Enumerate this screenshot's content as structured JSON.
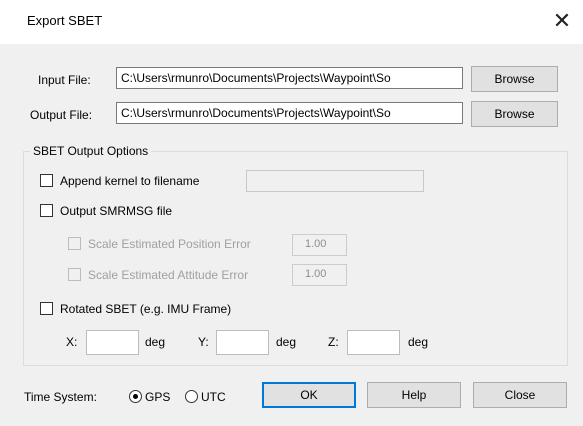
{
  "window": {
    "title": "Export SBET",
    "close_glyph": "✕"
  },
  "input_file": {
    "label": "Input File:",
    "value": "C:\\Users\\rmunro\\Documents\\Projects\\Waypoint\\So",
    "browse_label": "Browse"
  },
  "output_file": {
    "label": "Output File:",
    "value": "C:\\Users\\rmunro\\Documents\\Projects\\Waypoint\\So",
    "browse_label": "Browse"
  },
  "options": {
    "group_title": "SBET Output Options",
    "append_kernel": {
      "label": "Append kernel to filename",
      "checked": false,
      "value": ""
    },
    "output_smrmsg": {
      "label": "Output SMRMSG file",
      "checked": false
    },
    "scale_position": {
      "label": "Scale Estimated Position Error",
      "value": "1.00",
      "enabled": false
    },
    "scale_attitude": {
      "label": "Scale Estimated Attitude Error",
      "value": "1.00",
      "enabled": false
    },
    "rotated_sbet": {
      "label": "Rotated SBET (e.g. IMU Frame)",
      "checked": false
    },
    "rotation": {
      "x_label": "X:",
      "y_label": "Y:",
      "z_label": "Z:",
      "unit": "deg",
      "x_value": "",
      "y_value": "",
      "z_value": ""
    }
  },
  "time_system": {
    "label": "Time System:",
    "options": [
      "GPS",
      "UTC"
    ],
    "selected": "GPS"
  },
  "buttons": {
    "ok": "OK",
    "help": "Help",
    "close": "Close"
  },
  "colors": {
    "accent": "#0078d7",
    "background": "#f0f0f0"
  }
}
